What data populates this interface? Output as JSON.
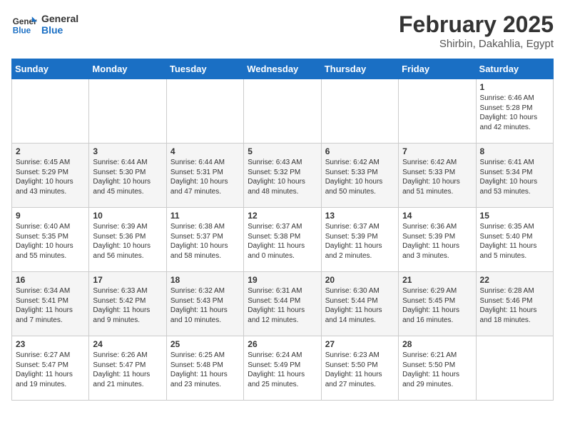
{
  "header": {
    "logo_line1": "General",
    "logo_line2": "Blue",
    "month": "February 2025",
    "location": "Shirbin, Dakahlia, Egypt"
  },
  "days_of_week": [
    "Sunday",
    "Monday",
    "Tuesday",
    "Wednesday",
    "Thursday",
    "Friday",
    "Saturday"
  ],
  "weeks": [
    [
      {
        "day": "",
        "info": ""
      },
      {
        "day": "",
        "info": ""
      },
      {
        "day": "",
        "info": ""
      },
      {
        "day": "",
        "info": ""
      },
      {
        "day": "",
        "info": ""
      },
      {
        "day": "",
        "info": ""
      },
      {
        "day": "1",
        "info": "Sunrise: 6:46 AM\nSunset: 5:28 PM\nDaylight: 10 hours and 42 minutes."
      }
    ],
    [
      {
        "day": "2",
        "info": "Sunrise: 6:45 AM\nSunset: 5:29 PM\nDaylight: 10 hours and 43 minutes."
      },
      {
        "day": "3",
        "info": "Sunrise: 6:44 AM\nSunset: 5:30 PM\nDaylight: 10 hours and 45 minutes."
      },
      {
        "day": "4",
        "info": "Sunrise: 6:44 AM\nSunset: 5:31 PM\nDaylight: 10 hours and 47 minutes."
      },
      {
        "day": "5",
        "info": "Sunrise: 6:43 AM\nSunset: 5:32 PM\nDaylight: 10 hours and 48 minutes."
      },
      {
        "day": "6",
        "info": "Sunrise: 6:42 AM\nSunset: 5:33 PM\nDaylight: 10 hours and 50 minutes."
      },
      {
        "day": "7",
        "info": "Sunrise: 6:42 AM\nSunset: 5:33 PM\nDaylight: 10 hours and 51 minutes."
      },
      {
        "day": "8",
        "info": "Sunrise: 6:41 AM\nSunset: 5:34 PM\nDaylight: 10 hours and 53 minutes."
      }
    ],
    [
      {
        "day": "9",
        "info": "Sunrise: 6:40 AM\nSunset: 5:35 PM\nDaylight: 10 hours and 55 minutes."
      },
      {
        "day": "10",
        "info": "Sunrise: 6:39 AM\nSunset: 5:36 PM\nDaylight: 10 hours and 56 minutes."
      },
      {
        "day": "11",
        "info": "Sunrise: 6:38 AM\nSunset: 5:37 PM\nDaylight: 10 hours and 58 minutes."
      },
      {
        "day": "12",
        "info": "Sunrise: 6:37 AM\nSunset: 5:38 PM\nDaylight: 11 hours and 0 minutes."
      },
      {
        "day": "13",
        "info": "Sunrise: 6:37 AM\nSunset: 5:39 PM\nDaylight: 11 hours and 2 minutes."
      },
      {
        "day": "14",
        "info": "Sunrise: 6:36 AM\nSunset: 5:39 PM\nDaylight: 11 hours and 3 minutes."
      },
      {
        "day": "15",
        "info": "Sunrise: 6:35 AM\nSunset: 5:40 PM\nDaylight: 11 hours and 5 minutes."
      }
    ],
    [
      {
        "day": "16",
        "info": "Sunrise: 6:34 AM\nSunset: 5:41 PM\nDaylight: 11 hours and 7 minutes."
      },
      {
        "day": "17",
        "info": "Sunrise: 6:33 AM\nSunset: 5:42 PM\nDaylight: 11 hours and 9 minutes."
      },
      {
        "day": "18",
        "info": "Sunrise: 6:32 AM\nSunset: 5:43 PM\nDaylight: 11 hours and 10 minutes."
      },
      {
        "day": "19",
        "info": "Sunrise: 6:31 AM\nSunset: 5:44 PM\nDaylight: 11 hours and 12 minutes."
      },
      {
        "day": "20",
        "info": "Sunrise: 6:30 AM\nSunset: 5:44 PM\nDaylight: 11 hours and 14 minutes."
      },
      {
        "day": "21",
        "info": "Sunrise: 6:29 AM\nSunset: 5:45 PM\nDaylight: 11 hours and 16 minutes."
      },
      {
        "day": "22",
        "info": "Sunrise: 6:28 AM\nSunset: 5:46 PM\nDaylight: 11 hours and 18 minutes."
      }
    ],
    [
      {
        "day": "23",
        "info": "Sunrise: 6:27 AM\nSunset: 5:47 PM\nDaylight: 11 hours and 19 minutes."
      },
      {
        "day": "24",
        "info": "Sunrise: 6:26 AM\nSunset: 5:47 PM\nDaylight: 11 hours and 21 minutes."
      },
      {
        "day": "25",
        "info": "Sunrise: 6:25 AM\nSunset: 5:48 PM\nDaylight: 11 hours and 23 minutes."
      },
      {
        "day": "26",
        "info": "Sunrise: 6:24 AM\nSunset: 5:49 PM\nDaylight: 11 hours and 25 minutes."
      },
      {
        "day": "27",
        "info": "Sunrise: 6:23 AM\nSunset: 5:50 PM\nDaylight: 11 hours and 27 minutes."
      },
      {
        "day": "28",
        "info": "Sunrise: 6:21 AM\nSunset: 5:50 PM\nDaylight: 11 hours and 29 minutes."
      },
      {
        "day": "",
        "info": ""
      }
    ]
  ]
}
